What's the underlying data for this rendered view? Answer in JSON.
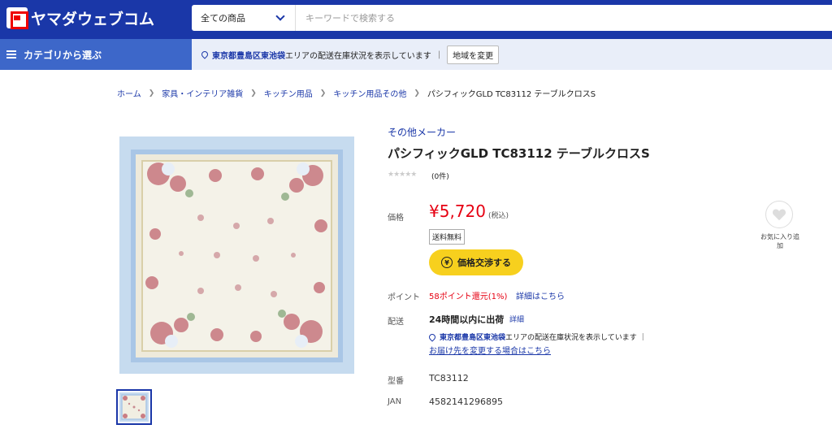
{
  "header": {
    "logo_text": "ヤマダウェブコム",
    "category_select": "全ての商品",
    "search_placeholder": "キーワードで検索する",
    "category_menu": "カテゴリから選ぶ",
    "area_city": "東京都豊島区東池袋",
    "area_text": " エリアの配送在庫状況を表示しています",
    "area_sep": "|",
    "area_button": "地域を変更"
  },
  "breadcrumb": [
    "ホーム",
    "家具・インテリア雑貨",
    "キッチン用品",
    "キッチン用品その他",
    "パシフィックGLD TC83112 テーブルクロスS"
  ],
  "product": {
    "maker": "その他メーカー",
    "title": "パシフィックGLD TC83112 テーブルクロスS",
    "stars": "★★★★★",
    "rating": 0,
    "review_count": "(0件)",
    "price_label": "価格",
    "price": "¥5,720",
    "tax": "(税込)",
    "free_shipping": "送料無料",
    "negotiate_icon": "¥",
    "negotiate": "価格交渉する",
    "points_label": "ポイント",
    "points": "58ポイント還元(1%)",
    "points_link": "詳細はこちら",
    "delivery_label": "配送",
    "delivery": "24時間以内に出荷",
    "delivery_link": "詳細",
    "delivery_area_city": "東京都豊島区東池袋",
    "delivery_area_text": " エリアの配送在庫状況を表示しています",
    "delivery_sep": "|",
    "change_address": "お届け先を変更する場合はこちら",
    "model_label": "型番",
    "model": "TC83112",
    "jan_label": "JAN",
    "jan": "4582141296895",
    "favorite_label": "お気に入り追加"
  },
  "colors": {
    "brand": "#1a37a8",
    "price": "#e60012",
    "negotiate_button": "#f7d01e"
  }
}
